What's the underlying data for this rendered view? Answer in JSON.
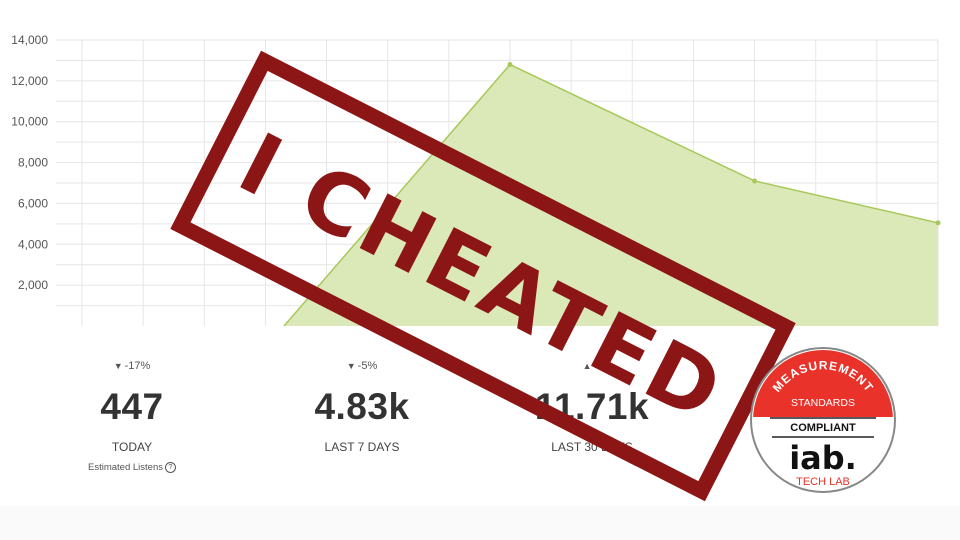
{
  "chart_data": {
    "type": "area",
    "x": [
      1,
      2,
      3,
      4,
      5,
      6,
      7,
      8,
      9,
      10,
      11,
      12,
      13,
      14,
      15
    ],
    "values": [
      null,
      null,
      null,
      null,
      null,
      null,
      null,
      12800,
      null,
      null,
      null,
      7100,
      null,
      null,
      5050
    ],
    "ylim": [
      0,
      14000
    ],
    "yticks": [
      "14,000",
      "12,000",
      "10,000",
      "8,000",
      "6,000",
      "4,000",
      "2,000"
    ],
    "grid": true,
    "fill_color": "#dbe8b8",
    "line_color": "#a8c85a"
  },
  "stats": [
    {
      "change": "-17%",
      "direction": "down",
      "value": "447",
      "caption": "TODAY",
      "note": "Estimated Listens"
    },
    {
      "change": "-5%",
      "direction": "down",
      "value": "4.83k",
      "caption": "LAST 7 DAYS"
    },
    {
      "change": "∞",
      "direction": "up",
      "value": "11.71k",
      "caption": "LAST 30 DAYS"
    }
  ],
  "stamp": {
    "text": "I CHEATED",
    "color": "#8c1616"
  },
  "badge": {
    "top_text": "MEASUREMENT",
    "line1": "STANDARDS",
    "line2": "COMPLIANT",
    "logo": "iab.",
    "sub": "TECH LAB",
    "accent": "#e8322a"
  },
  "icons": {
    "info": "info-icon",
    "down": "triangle-down-icon",
    "up": "triangle-up-icon"
  }
}
